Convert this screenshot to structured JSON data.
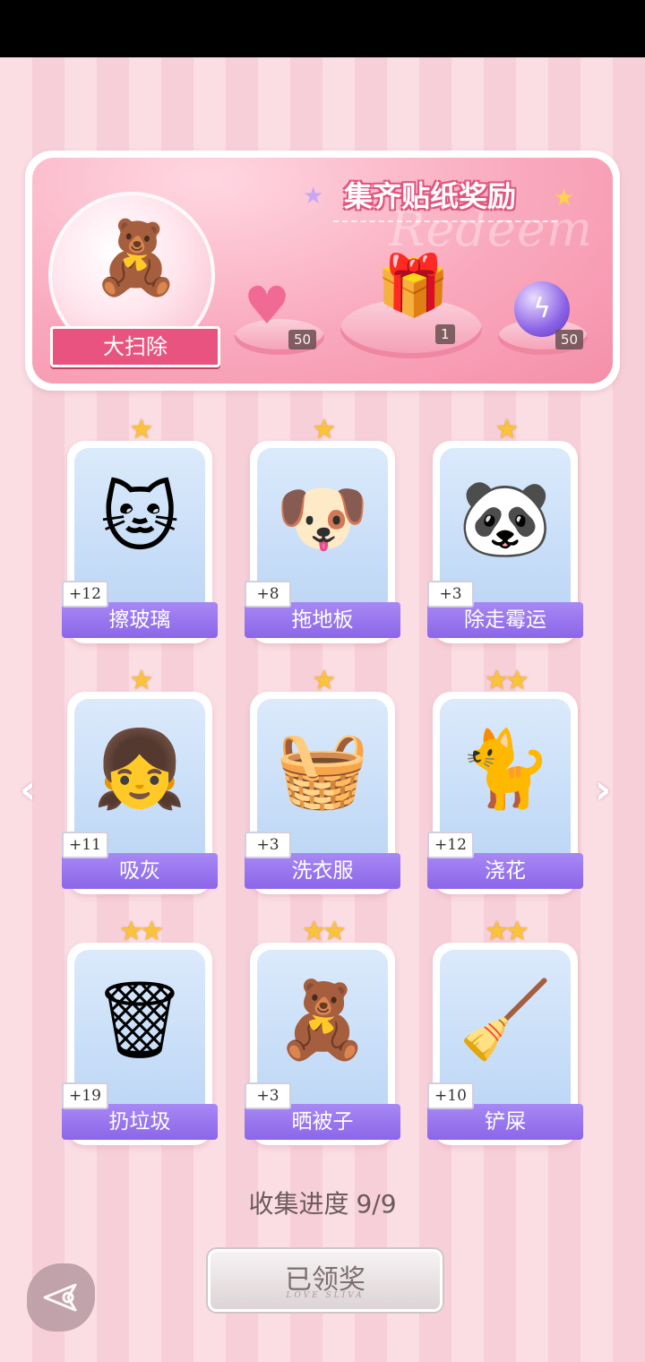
{
  "banner": {
    "title": "集齐贴纸奖励",
    "watermark": "Redeem",
    "theme_label": "大扫除",
    "rewards": [
      {
        "icon": "pink-heart-gem-icon",
        "count": "50"
      },
      {
        "icon": "gift-box-icon",
        "count": "1"
      },
      {
        "icon": "purple-energy-orb-icon",
        "count": "50"
      }
    ]
  },
  "cards": [
    {
      "name": "擦玻璃",
      "count": "+12",
      "stars": "★",
      "icon": "cat-cleaning-window-icon"
    },
    {
      "name": "拖地板",
      "count": "+8",
      "stars": "★",
      "icon": "corgi-mopping-icon"
    },
    {
      "name": "除走霉运",
      "count": "+3",
      "stars": "★",
      "icon": "panda-sweeping-icon"
    },
    {
      "name": "吸灰",
      "count": "+11",
      "stars": "★",
      "icon": "girl-vacuuming-icon"
    },
    {
      "name": "洗衣服",
      "count": "+3",
      "stars": "★",
      "icon": "cat-in-washing-machine-icon"
    },
    {
      "name": "浇花",
      "count": "+12",
      "stars": "★★",
      "icon": "cat-watering-plant-icon"
    },
    {
      "name": "扔垃圾",
      "count": "+19",
      "stars": "★★",
      "icon": "girl-taking-out-trash-icon"
    },
    {
      "name": "晒被子",
      "count": "+3",
      "stars": "★★",
      "icon": "bear-hanging-quilt-icon"
    },
    {
      "name": "铲屎",
      "count": "+10",
      "stars": "★★",
      "icon": "girl-cleaning-litter-icon"
    }
  ],
  "progress": {
    "label": "收集进度",
    "value": "9/9"
  },
  "claim_button": {
    "label": "已领奖",
    "sub": "LOVE SLIVA"
  }
}
